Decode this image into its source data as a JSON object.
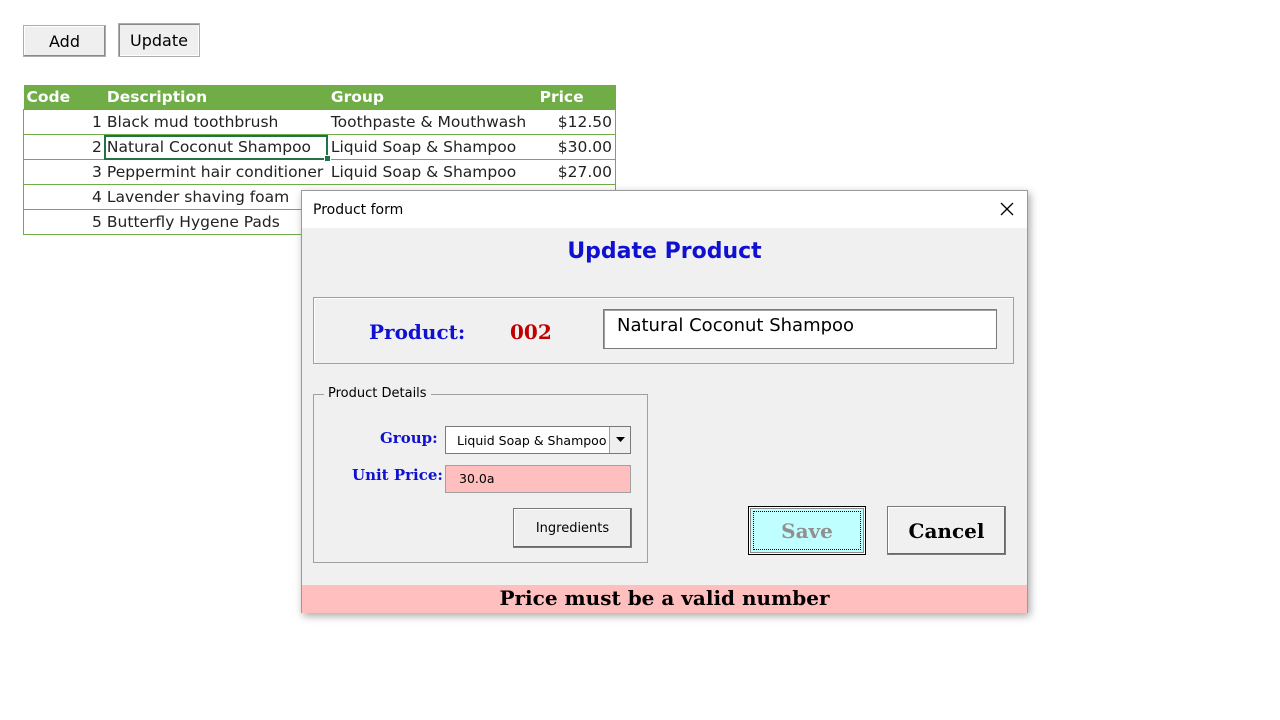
{
  "sheet_buttons": {
    "add": "Add",
    "update": "Update"
  },
  "table": {
    "headers": [
      "Code",
      "Description",
      "Group",
      "Price"
    ],
    "rows": [
      {
        "code": "1",
        "description": "Black mud toothbrush",
        "group": "Toothpaste & Mouthwash",
        "price": "$12.50"
      },
      {
        "code": "2",
        "description": "Natural Coconut Shampoo",
        "group": "Liquid Soap & Shampoo",
        "price": "$30.00"
      },
      {
        "code": "3",
        "description": "Peppermint hair conditioner",
        "group": "Liquid Soap & Shampoo",
        "price": "$27.00"
      },
      {
        "code": "4",
        "description": "Lavender shaving foam",
        "group": "",
        "price": ""
      },
      {
        "code": "5",
        "description": "Butterfly Hygene Pads",
        "group": "",
        "price": ""
      }
    ]
  },
  "dialog": {
    "title": "Product form",
    "heading": "Update Product",
    "product_label": "Product:",
    "product_code": "002",
    "product_name": "Natural Coconut Shampoo",
    "details_legend": "Product Details",
    "group_label": "Group:",
    "group_value": "Liquid Soap & Shampoo",
    "unit_price_label": "Unit Price:",
    "unit_price_value": "30.0a",
    "ingredients_button": "Ingredients",
    "save_button": "Save",
    "cancel_button": "Cancel",
    "status_message": "Price must be a valid number",
    "icons": {
      "close": "close-icon",
      "dropdown": "chevron-down-icon"
    },
    "colors": {
      "heading": "#1010d0",
      "code": "#c00000",
      "error_bg": "#ffbfbf",
      "save_bg": "#c0ffff",
      "table_header": "#70ad47"
    }
  }
}
